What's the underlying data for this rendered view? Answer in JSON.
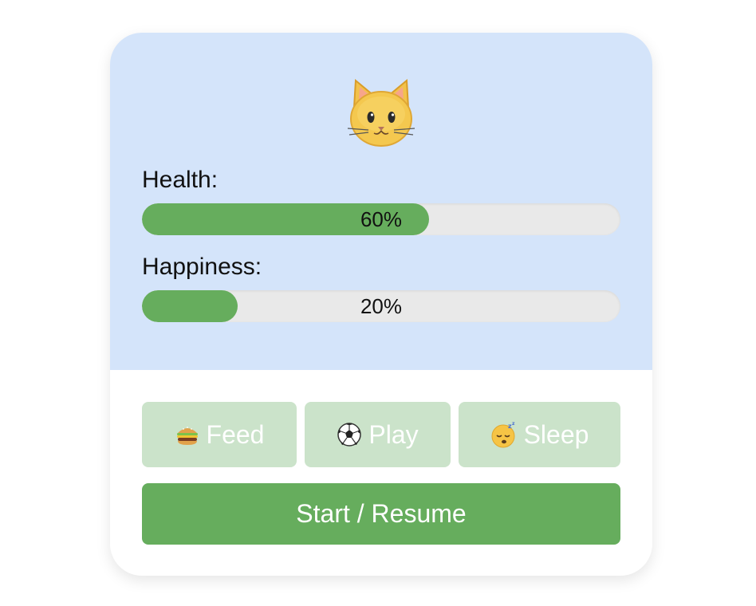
{
  "pet": {
    "avatar_icon": "cat-face-icon"
  },
  "stats": {
    "health": {
      "label": "Health:",
      "value": 60,
      "display": "60%"
    },
    "happiness": {
      "label": "Happiness:",
      "value": 20,
      "display": "20%"
    }
  },
  "actions": {
    "feed": {
      "label": "Feed",
      "icon": "hamburger-icon"
    },
    "play": {
      "label": "Play",
      "icon": "soccer-ball-icon"
    },
    "sleep": {
      "label": "Sleep",
      "icon": "sleeping-face-icon"
    }
  },
  "start_button": {
    "label": "Start / Resume"
  },
  "colors": {
    "panel_bg": "#d4e4fa",
    "bar_fill": "#66ad5d",
    "bar_track": "#e9e9e9",
    "action_btn_disabled": "#cbe3ca",
    "start_btn": "#66ad5d"
  }
}
